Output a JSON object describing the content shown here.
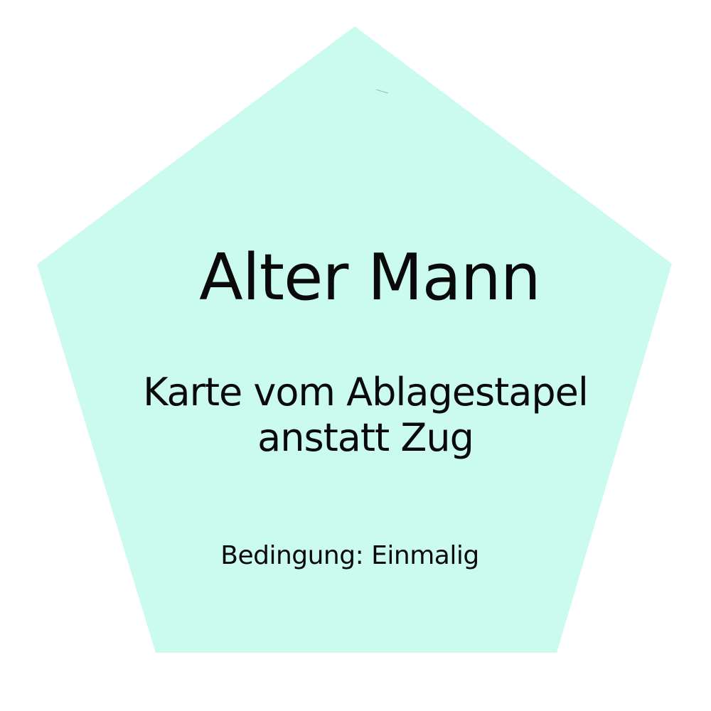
{
  "card": {
    "fill_color": "#cbfbee",
    "title": "Alter Mann",
    "effect_lines": [
      "Karte vom Ablagestapel",
      "anstatt Zug"
    ],
    "condition": "Bedingung: Einmalig"
  }
}
